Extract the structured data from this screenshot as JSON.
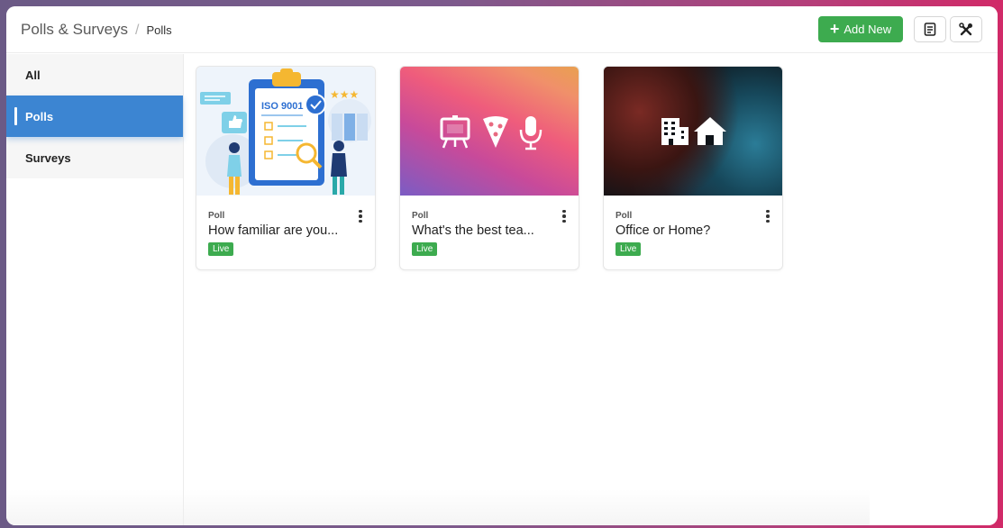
{
  "breadcrumb": {
    "root": "Polls & Surveys",
    "separator": "/",
    "current": "Polls"
  },
  "toolbar": {
    "add_label": "Add New",
    "accent": "#3dab4f"
  },
  "sidebar": {
    "items": [
      {
        "label": "All",
        "active": false
      },
      {
        "label": "Polls",
        "active": true
      },
      {
        "label": "Surveys",
        "active": false
      }
    ],
    "active_color": "#3c85d2"
  },
  "cards": [
    {
      "type": "Poll",
      "title": "How familiar are you...",
      "status": "Live",
      "image_text": "ISO 9001",
      "thumbnail": "iso-9001-illustration"
    },
    {
      "type": "Poll",
      "title": "What's the best tea...",
      "status": "Live",
      "thumbnail": "pink-orange-gradient-with-board-pizza-mic-icons"
    },
    {
      "type": "Poll",
      "title": "Office or Home?",
      "status": "Live",
      "thumbnail": "dark-blurred-with-building-home-icons"
    }
  ]
}
